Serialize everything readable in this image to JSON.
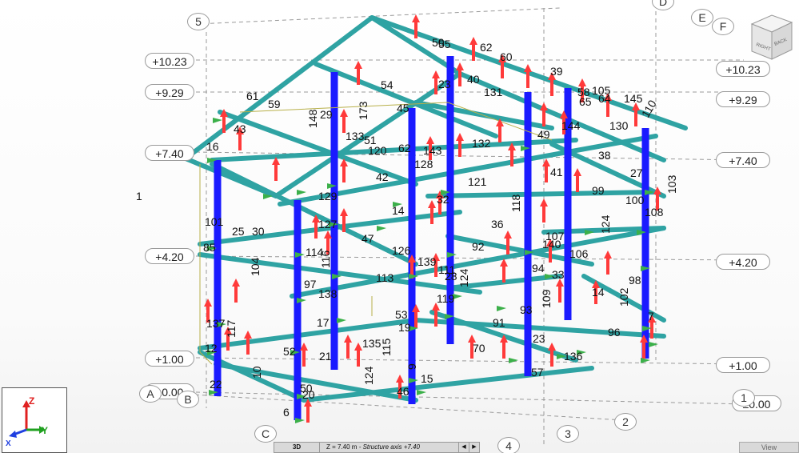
{
  "viewport": {
    "level_tags_left": [
      "+10.23",
      "+9.29",
      "+7.40",
      "+4.20",
      "+1.00",
      "±0.00"
    ],
    "level_tags_right": [
      "+10.23",
      "+9.29",
      "+7.40",
      "+4.20",
      "+1.00",
      "±0.00"
    ],
    "axis_tags": [
      "5",
      "D",
      "E",
      "F",
      "A",
      "B",
      "C",
      "1",
      "2",
      "3",
      "4"
    ],
    "member_labels": [
      "55",
      "62",
      "60",
      "39",
      "105",
      "145",
      "110",
      "58",
      "65",
      "64",
      "40",
      "131",
      "45",
      "50",
      "54",
      "23",
      "61",
      "59",
      "43",
      "16",
      "29",
      "148",
      "173",
      "133",
      "51",
      "120",
      "62",
      "143",
      "132",
      "49",
      "144",
      "130",
      "38",
      "128",
      "121",
      "27",
      "103",
      "129",
      "42",
      "41",
      "99",
      "100",
      "14",
      "32",
      "108",
      "101",
      "118",
      "124",
      "25",
      "30",
      "127",
      "47",
      "92",
      "36",
      "107",
      "140",
      "106",
      "85",
      "114",
      "116",
      "126",
      "139",
      "111",
      "104",
      "113",
      "28",
      "94",
      "33",
      "97",
      "138",
      "124",
      "14",
      "98",
      "102",
      "137",
      "117",
      "17",
      "53",
      "19",
      "119",
      "91",
      "93",
      "109",
      "7",
      "96",
      "12",
      "52",
      "115",
      "135",
      "70",
      "23",
      "136",
      "22",
      "10",
      "50",
      "124",
      "15",
      "21",
      "9",
      "57",
      "20",
      "46",
      "6",
      "1"
    ],
    "colors": {
      "beam": "#2fa3a3",
      "column": "#1a1aff",
      "load_arrow": "#ff3a3a",
      "support_arrow": "#3cb04a",
      "grid_line": "#9a9a9a"
    }
  },
  "view_cube": {
    "face_right": "RIGHT",
    "face_back": "BACK"
  },
  "triad": {
    "z": "Z",
    "y": "Y",
    "x": "X"
  },
  "status_bar": {
    "view_mode": "3D",
    "plane": "Z = 7.40 m",
    "plane_desc": " - Structure axis +7.40"
  },
  "view_tab": {
    "label": "View"
  }
}
